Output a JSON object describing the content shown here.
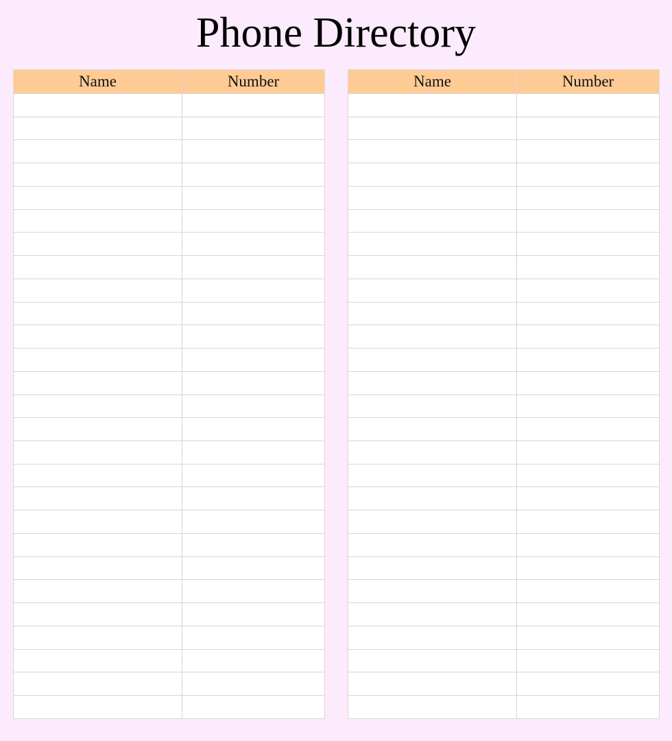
{
  "title": "Phone Directory",
  "colors": {
    "page_background": "#fcebfc",
    "header_background": "#fecb95",
    "grid_line": "#d6d6d6"
  },
  "tables": [
    {
      "id": "left",
      "headers": [
        "Name",
        "Number"
      ],
      "row_count": 27,
      "rows": []
    },
    {
      "id": "right",
      "headers": [
        "Name",
        "Number"
      ],
      "row_count": 27,
      "rows": []
    }
  ]
}
